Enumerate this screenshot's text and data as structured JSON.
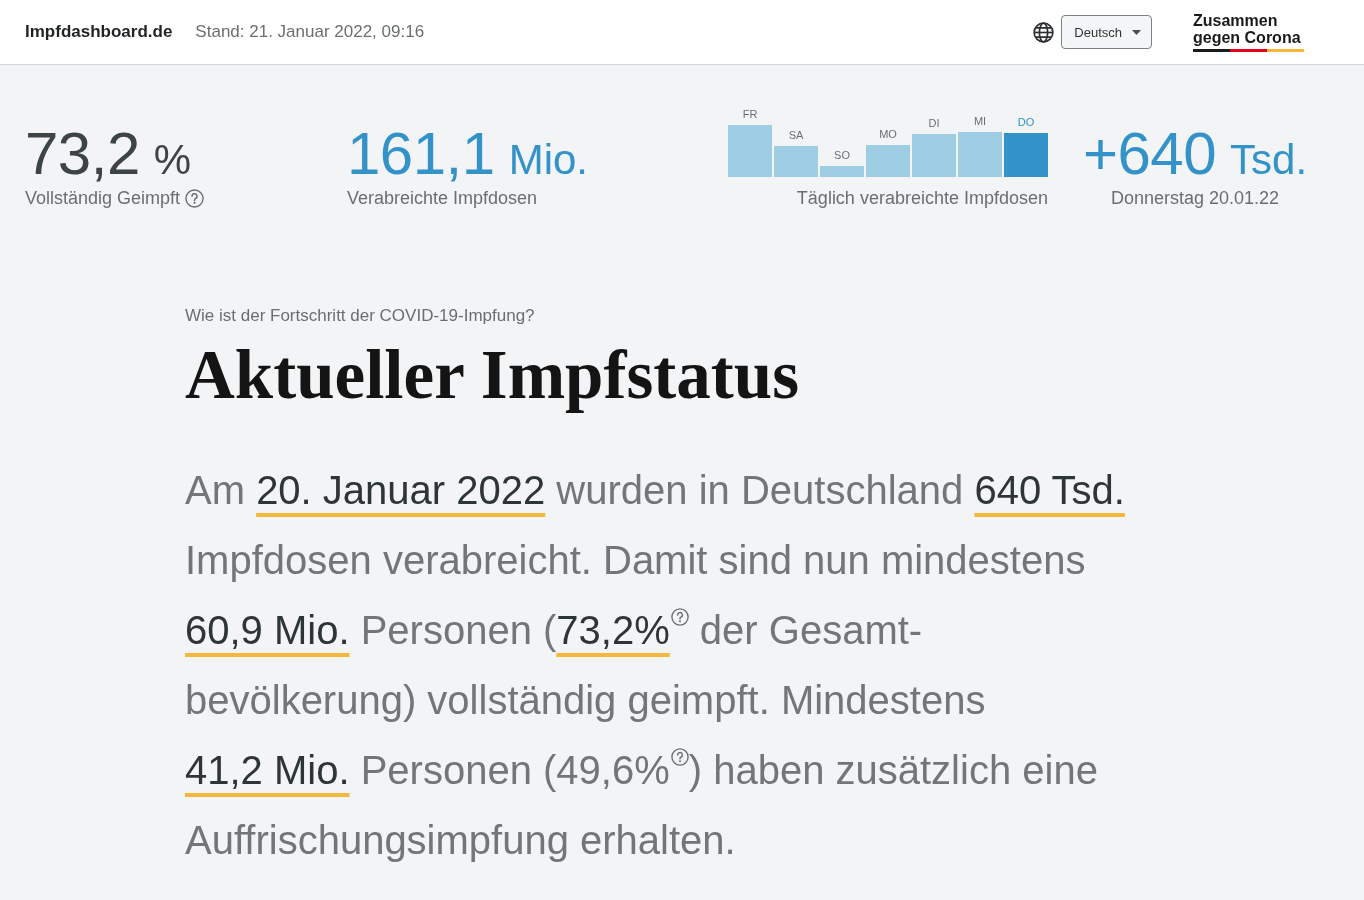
{
  "header": {
    "site_name": "Impfdashboard.de",
    "last_updated": "Stand: 21. Januar 2022, 09:16",
    "language_select": {
      "value": "Deutsch"
    },
    "logo": {
      "text": "Zusammen gegen Corona"
    }
  },
  "key_figures": [
    {
      "kind": "figure",
      "value": "73,2",
      "unit": "%",
      "label": "Vollständig Geimpft",
      "help": true,
      "color": "#3c4447"
    },
    {
      "kind": "figure",
      "value": "161,1",
      "unit": "Mio.",
      "label": "Verabreichte Impfdosen",
      "color": "#3392c7"
    },
    {
      "kind": "daily_chart",
      "caption": "Täglich verabreichte Impfdosen",
      "days": [
        {
          "label": "FR",
          "selected": false
        },
        {
          "label": "SA",
          "selected": false
        },
        {
          "label": "SO",
          "selected": false
        },
        {
          "label": "MO",
          "selected": false
        },
        {
          "label": "DI",
          "selected": false
        },
        {
          "label": "MI",
          "selected": false
        },
        {
          "label": "DO",
          "selected": true
        }
      ]
    },
    {
      "kind": "latest",
      "value": "+640",
      "unit": "Tsd.",
      "label": "Donnerstag 20.01.22",
      "color": "#3392c7"
    }
  ],
  "article": {
    "kicker": "Wie ist der Fortschritt der COVID-19-Impfung?",
    "heading": "Aktueller Impfstatus",
    "segments": [
      {
        "kind": "plain",
        "text": "Am "
      },
      {
        "kind": "highlight",
        "text": "20. Januar 2022"
      },
      {
        "kind": "plain",
        "text": " wurden in Deutschland "
      },
      {
        "kind": "highlight",
        "text": "640 Tsd."
      },
      {
        "kind": "plain",
        "text": "\nImpfdosen verabreicht. Damit sind nun mindestens\n"
      },
      {
        "kind": "highlight",
        "text": "60,9 Mio."
      },
      {
        "kind": "plain",
        "text": " Personen ("
      },
      {
        "kind": "highlight",
        "text": "73,2%"
      },
      {
        "kind": "help"
      },
      {
        "kind": "plain",
        "text": " der Gesamt-\nbevölkerung) vollständig geimpft. Mindestens\n"
      },
      {
        "kind": "highlight",
        "text": "41,2 Mio."
      },
      {
        "kind": "plain",
        "text": " Personen (49,6%"
      },
      {
        "kind": "help"
      },
      {
        "kind": "plain",
        "text": ") haben zusätzlich eine\nAuffrischungsimpfung erhalten."
      }
    ]
  }
}
